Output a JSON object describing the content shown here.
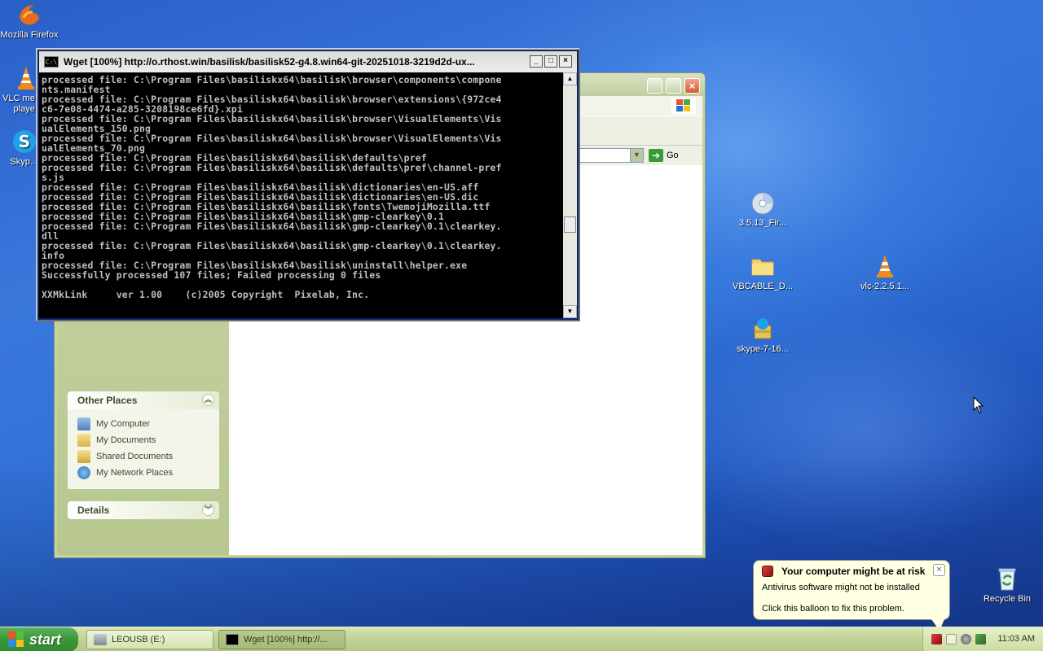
{
  "desktop": {
    "icons": [
      {
        "label": "Mozilla Firefox"
      },
      {
        "label": "VLC me... playe..."
      },
      {
        "label": "Skyp..."
      },
      {
        "label": "3.5.13_Fir..."
      },
      {
        "label": "VBCABLE_D..."
      },
      {
        "label": "vlc-2.2.5.1..."
      },
      {
        "label": "skype-7-16..."
      },
      {
        "label": "Recycle Bin"
      }
    ]
  },
  "explorer": {
    "go_label": "Go",
    "other_places": {
      "title": "Other Places",
      "items": [
        "My Computer",
        "My Documents",
        "Shared Documents",
        "My Network Places"
      ]
    },
    "details": {
      "title": "Details"
    }
  },
  "console": {
    "title": "Wget [100%] http://o.rthost.win/basilisk/basilisk52-g4.8.win64-git-20251018-3219d2d-ux...",
    "lines": [
      "nts.manifest",
      "processed file: C:\\Program Files\\basiliskx64\\basilisk\\browser\\extensions\\{972ce4",
      "c6-7e08-4474-a285-3208198ce6fd}.xpi",
      "processed file: C:\\Program Files\\basiliskx64\\basilisk\\browser\\VisualElements\\Vis",
      "ualElements_150.png",
      "processed file: C:\\Program Files\\basiliskx64\\basilisk\\browser\\VisualElements\\Vis",
      "ualElements_70.png",
      "processed file: C:\\Program Files\\basiliskx64\\basilisk\\defaults\\pref",
      "processed file: C:\\Program Files\\basiliskx64\\basilisk\\defaults\\pref\\channel-pref",
      "s.js",
      "processed file: C:\\Program Files\\basiliskx64\\basilisk\\dictionaries\\en-US.aff",
      "processed file: C:\\Program Files\\basiliskx64\\basilisk\\dictionaries\\en-US.dic",
      "processed file: C:\\Program Files\\basiliskx64\\basilisk\\fonts\\TwemojiMozilla.ttf",
      "processed file: C:\\Program Files\\basiliskx64\\basilisk\\gmp-clearkey\\0.1",
      "processed file: C:\\Program Files\\basiliskx64\\basilisk\\gmp-clearkey\\0.1\\clearkey.",
      "dll",
      "processed file: C:\\Program Files\\basiliskx64\\basilisk\\gmp-clearkey\\0.1\\clearkey.",
      "info",
      "processed file: C:\\Program Files\\basiliskx64\\basilisk\\uninstall\\helper.exe",
      "Successfully processed 107 files; Failed processing 0 files",
      "",
      "XXMkLink     ver 1.00    (c)2005 Copyright  Pixelab, Inc."
    ],
    "first_partial": "processed file: C:\\Program Files\\basiliskx64\\basilisk\\browser\\components\\compone"
  },
  "balloon": {
    "title": "Your computer might be at risk",
    "line1": "Antivirus software might not be installed",
    "line2": "Click this balloon to fix this problem."
  },
  "taskbar": {
    "start_label": "start",
    "tasks": [
      {
        "label": "LEOUSB (E:)"
      },
      {
        "label": "Wget [100%] http://..."
      }
    ],
    "clock": "11:03 AM"
  }
}
